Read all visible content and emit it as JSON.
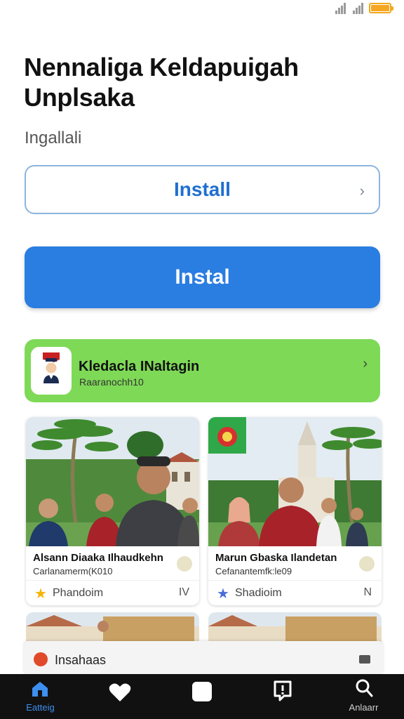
{
  "header": {
    "title_line1": "Nennaliga Keldapuigah",
    "title_line2": "Unplsaka",
    "subtitle": "Ingallali"
  },
  "buttons": {
    "install_outline_label": "Install",
    "install_primary_label": "Instal"
  },
  "featured_app": {
    "name": "Kledacla INaltagin",
    "subtitle": "Raaranochh10"
  },
  "cards": [
    {
      "title": "Alsann Diaaka Ilhaudkehn",
      "subtitle": "Carlanamerm(K010",
      "footer_label": "Phandoim",
      "footer_icon": "star-icon",
      "footer_right": "IV"
    },
    {
      "title": "Marun Gbaska Ilandetan",
      "subtitle": "Cefanantemfk:le09",
      "footer_label": "Shadioim",
      "footer_icon": "star-icon",
      "footer_right": "N"
    }
  ],
  "inline_banner": {
    "label": "Insahaas"
  },
  "tab_bar": {
    "items": [
      {
        "label": "Eatteig",
        "icon": "home-icon",
        "active": true
      },
      {
        "label": "",
        "icon": "heart-icon",
        "active": false
      },
      {
        "label": "",
        "icon": "square-icon",
        "active": false
      },
      {
        "label": "",
        "icon": "alert-icon",
        "active": false
      },
      {
        "label": "Anlaarr",
        "icon": "search-icon",
        "active": false
      }
    ]
  },
  "colors": {
    "accent_blue": "#2a7de1",
    "banner_green": "#7ed957",
    "battery": "#f5a623",
    "tab_bar_bg": "#111111"
  }
}
